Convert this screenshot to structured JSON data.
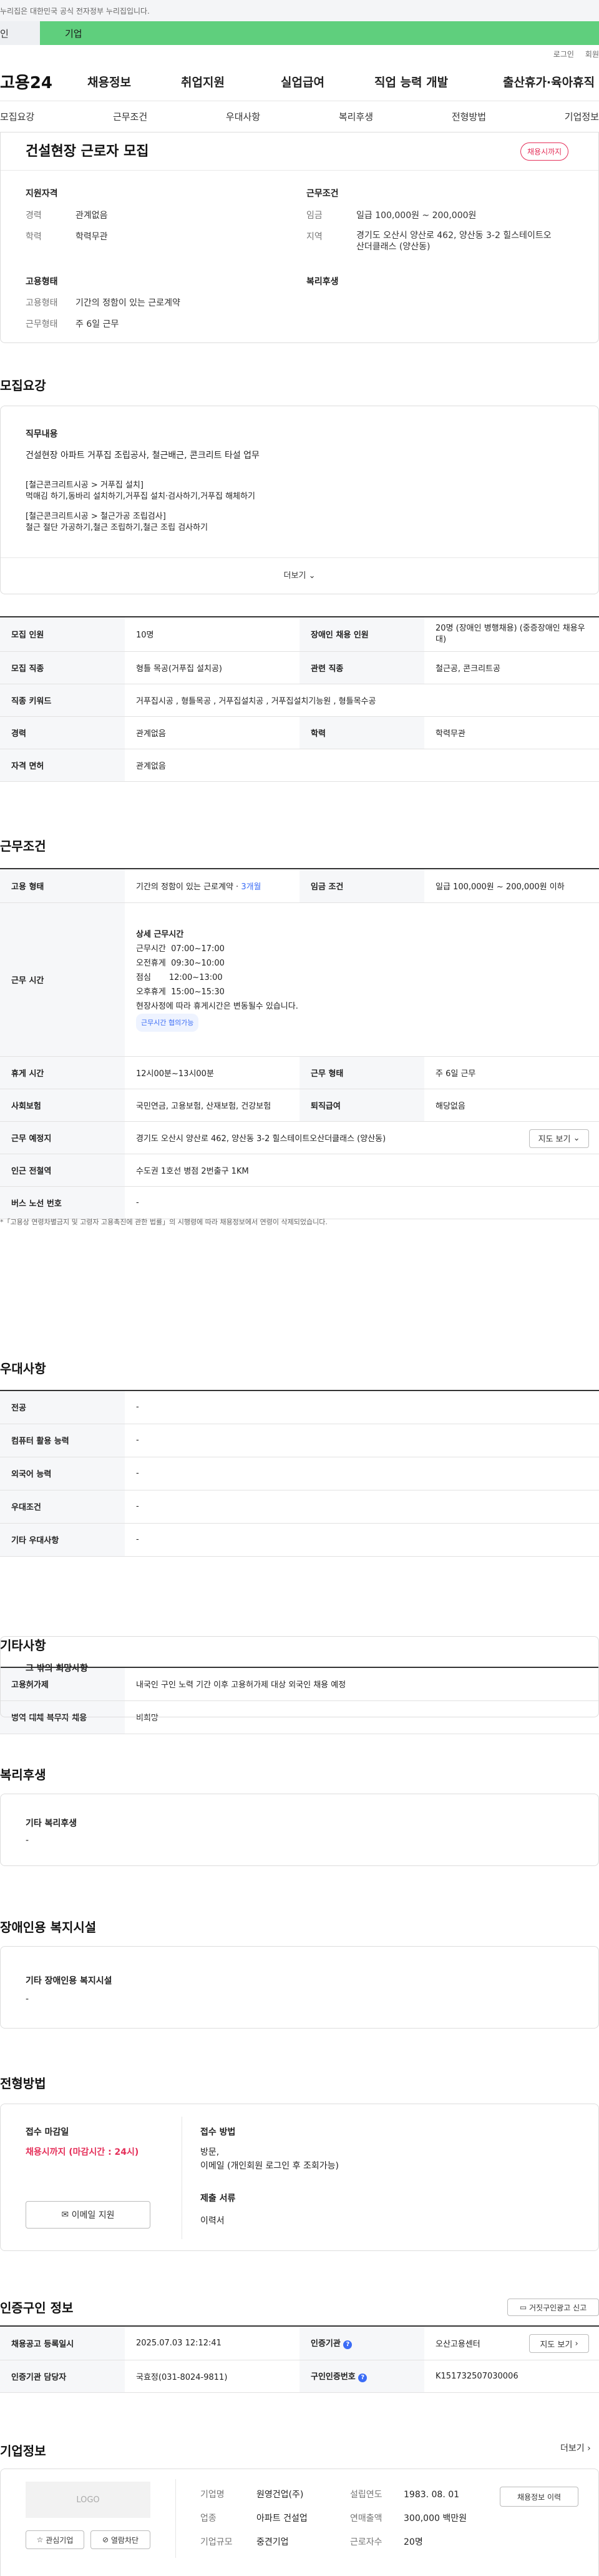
{
  "topbar": {
    "notice": "누리집은 대한민국 공식 전자정부 누리집입니다."
  },
  "toptabs": {
    "personal": "인",
    "company": "기업"
  },
  "util": {
    "login": "로그인",
    "join": "회원"
  },
  "gnb": {
    "logo": "고용24",
    "items": [
      "채용정보",
      "취업지원",
      "실업급여",
      "직업 능력 개발",
      "출산휴가·육아휴직"
    ]
  },
  "subtabs": [
    "모집요강",
    "근무조건",
    "우대사항",
    "복리후생",
    "전형방법",
    "기업정보"
  ],
  "summary": {
    "title": "건설현장 근로자 모집",
    "badge": "채용시까지",
    "qual_title": "지원자격",
    "cond_title": "근무조건",
    "emp_title": "고용형태",
    "welfare_title": "복리후생",
    "career_k": "경력",
    "career_v": "관계없음",
    "edu_k": "학력",
    "edu_v": "학력무관",
    "pay_k": "임금",
    "pay_v": "일급 100,000원 ~ 200,000원",
    "loc_k": "지역",
    "loc_v1": "경기도 오산시 양산로 462, 양산동 3-2 힐스테이트오",
    "loc_v2": "산더클래스 (양산동)",
    "etype_k": "고용형태",
    "etype_v": "기간의 정함이 있는 근로계약",
    "wtype_k": "근무형태",
    "wtype_v": "주 6일 근무"
  },
  "recruit": {
    "title": "모집요강",
    "duty_title": "직무내용",
    "duty_line": "건설현장 아파트 거푸집 조립공사, 철근배근, 콘크리트 타설 업무",
    "b1": "[철근콘크리트시공 > 거푸집 설치]",
    "b1d": "먹매김 하기,동바리 설치하기,거푸집 설치·검사하기,거푸집 해체하기",
    "b2": "[철근콘크리트시공 > 철근가공 조립검사]",
    "b2d": "철근 절단 가공하기,철근 조립하기,철근 조립 검사하기",
    "more": "더보기",
    "rows": {
      "count_k": "모집 인원",
      "count_v": "10명",
      "dis_k": "장애인 채용 인원",
      "dis_v1": "20명 (장애인 병행채용) (중증장애인 채용우",
      "dis_v2": "대)",
      "job_k": "모집 직종",
      "job_v": "형틀 목공(거푸집 설치공)",
      "rel_k": "관련 직종",
      "rel_v": "철근공, 콘크리트공",
      "kw_k": "직종 키워드",
      "kw_v": "거푸집시공 , 형틀목공 , 거푸집설치공 , 거푸집설치기능원 , 형틀목수공",
      "career_k": "경력",
      "career_v": "관계없음",
      "edu_k": "학력",
      "edu_v": "학력무관",
      "lic_k": "자격 면허",
      "lic_v": "관계없음"
    }
  },
  "workcond": {
    "title": "근무조건",
    "etype_k": "고용 형태",
    "etype_v": "기간의 정함이 있는 근로계약 · ",
    "etype_months": "3개월",
    "pay_k": "임금 조건",
    "pay_v": "일급 100,000원 ~ 200,000원 이하",
    "hours_k": "근무 시간",
    "hours_title": "상세 근무시간",
    "hours_lines": [
      "근무시간  07:00~17:00",
      "오전휴게  09:30~10:00",
      "점심       12:00~13:00",
      "오후휴게  15:00~15:30",
      "현장사정에 따라 휴게시간은 변동될수 있습니다."
    ],
    "hours_chip": "근무시간 협의가능",
    "rest_k": "휴게 시간",
    "rest_v": "12시00분~13시00분",
    "wtype_k": "근무 형태",
    "wtype_v": "주 6일 근무",
    "ins_k": "사회보험",
    "ins_v": "국민연금, 고용보험, 산재보험, 건강보험",
    "sev_k": "퇴직급여",
    "sev_v": "해당없음",
    "loc_k": "근무 예정지",
    "loc_v": "경기도 오산시 양산로 462, 양산동 3-2 힐스테이트오산더클래스 (양산동)",
    "map_btn": "지도 보기",
    "sub_k": "인근 전철역",
    "sub_v": "수도권 1호선 병점 2번출구 1KM",
    "bus_k": "버스 노선 번호",
    "bus_v": "-",
    "note": "*「고용상 연령차별금지 및 고령자 고용촉진에 관한 법률」의 시행령에 따라 채용정보에서 연령이 삭제되었습니다."
  },
  "pref": {
    "title": "우대사항",
    "rows": [
      {
        "k": "전공",
        "v": "-"
      },
      {
        "k": "컴퓨터 활용 능력",
        "v": "-"
      },
      {
        "k": "외국어 능력",
        "v": "-"
      },
      {
        "k": "우대조건",
        "v": "-"
      },
      {
        "k": "기타 우대사항",
        "v": "-"
      }
    ]
  },
  "etc": {
    "title": "기타사항",
    "emp_k": "고용허가제",
    "emp_v": "내국인 구인 노력 기간 이후 고용허가제 대상 외국인 채용 예정",
    "mil_k": "병역 대체 복무자 채용",
    "mil_v": "비희망",
    "other_title": "그 밖의 희망사항",
    "other_v": "-"
  },
  "welfare": {
    "title": "복리후생",
    "box_title": "기타 복리후생",
    "box_v": "-"
  },
  "disab": {
    "title": "장애인용 복지시설",
    "box_title": "기타 장애인용 복지시설",
    "box_v": "-"
  },
  "process": {
    "title": "전형방법",
    "deadline_k": "접수 마감일",
    "deadline_v": "채용시까지 (마감시간 : 24시)",
    "method_k": "접수 방법",
    "method_v1": "방문,",
    "method_v2": "이메일 (개인회원 로그인 후 조회가능)",
    "docs_k": "제출 서류",
    "docs_v": "이력서",
    "email_btn": "이메일 지원"
  },
  "cert": {
    "title": "인증구인 정보",
    "report_btn": "거짓구인광고 신고",
    "date_k": "채용공고 등록일시",
    "date_v": "2025.07.03 12:12:41",
    "org_k": "인증기관",
    "org_v": "오산고용센터",
    "map_btn": "지도 보기",
    "mgr_k": "인증기관 담당자",
    "mgr_v": "국효정(031-8024-9811)",
    "num_k": "구인인증번호",
    "num_v": "K151732507030006"
  },
  "company": {
    "title": "기업정보",
    "more": "더보기",
    "logo": "LOGO",
    "fav_btn": "관심기업",
    "block_btn": "열람차단",
    "name_k": "기업명",
    "name_v": "원영건업(주)",
    "ind_k": "업종",
    "ind_v": "아파트 건설업",
    "size_k": "기업규모",
    "size_v": "중견기업",
    "est_k": "설립연도",
    "est_v": "1983. 08. 01",
    "sales_k": "연매출액",
    "sales_v": "300,000 백만원",
    "emp_k": "근로자수",
    "emp_v": "20명",
    "jobs_btn": "채용정보 이력"
  }
}
